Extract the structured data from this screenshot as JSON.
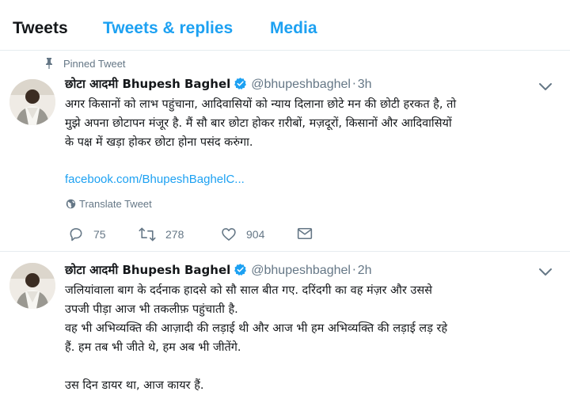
{
  "tabs": [
    {
      "label": "Tweets",
      "active": true
    },
    {
      "label": "Tweets & replies",
      "active": false
    },
    {
      "label": "Media",
      "active": false
    }
  ],
  "colors": {
    "accent": "#1da1f2",
    "muted": "#657786",
    "text": "#14171a",
    "border": "#e6ecf0"
  },
  "tweets": [
    {
      "pinned_label": "Pinned Tweet",
      "name": "छोटा आदमी Bhupesh Baghel",
      "handle": "@bhupeshbaghel",
      "time": "3h",
      "text": "अगर किसानों को लाभ पहुंचाना, आदिवासियों को न्याय दिलाना छोटे मन की छोटी हरकत है, तो\nमुझे अपना छोटापन मंजूर है. मैं सौ बार छोटा होकर ग़रीबों, मज़दूरों, किसानों और आदिवासियों\nके पक्ष में खड़ा होकर छोटा होना पसंद करुंगा.",
      "link": "facebook.com/BhupeshBaghelC...",
      "translate": "Translate Tweet",
      "replies": "75",
      "retweets": "278",
      "likes": "904"
    },
    {
      "name": "छोटा आदमी Bhupesh Baghel",
      "handle": "@bhupeshbaghel",
      "time": "2h",
      "text": "जलियांवाला बाग के दर्दनाक हादसे को सौ साल बीत गए. दरिंदगी का वह मंज़र और उससे\nउपजी पीड़ा आज भी तकलीफ़ पहुंचाती है.\nवह भी अभिव्यक्ति की आज़ादी की लड़ाई थी और आज भी हम अभिव्यक्ति की लड़ाई लड़ रहे\nहैं. हम तब भी जीते थे, हम अब भी जीतेंगे.\n\nउस दिन डायर था, आज कायर हैं."
    }
  ],
  "icons": {
    "pin": "pin-icon",
    "verified": "verified-badge-icon",
    "caret": "chevron-down-icon",
    "globe": "globe-icon",
    "reply": "reply-icon",
    "retweet": "retweet-icon",
    "like": "heart-icon",
    "dm": "envelope-icon"
  }
}
